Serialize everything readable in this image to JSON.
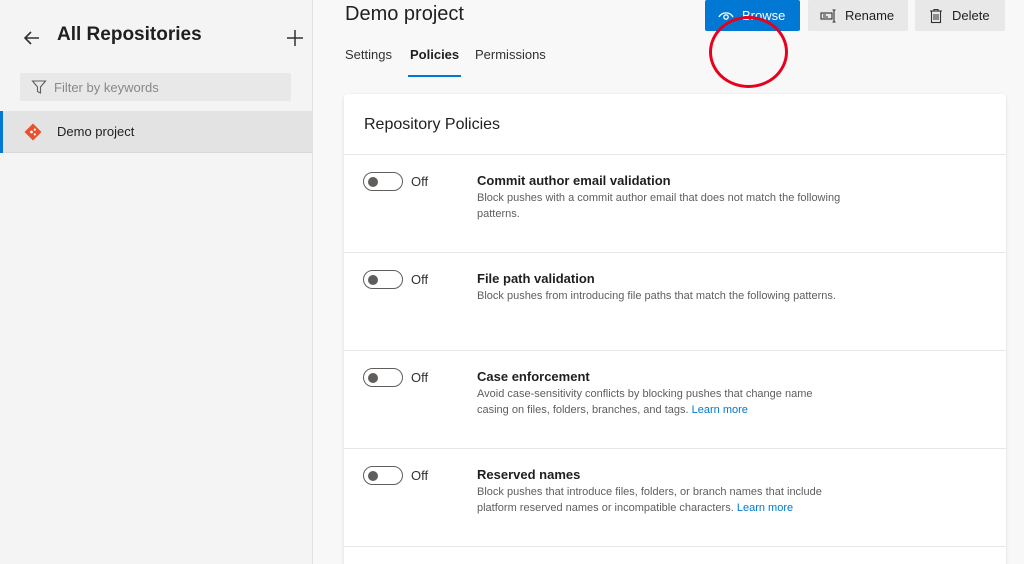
{
  "sidebar": {
    "title": "All Repositories",
    "filter_placeholder": "Filter by keywords",
    "repo_name": "Demo project"
  },
  "header": {
    "title": "Demo project",
    "browse_label": "Browse",
    "rename_label": "Rename",
    "delete_label": "Delete"
  },
  "tabs": [
    {
      "label": "Settings",
      "active": false
    },
    {
      "label": "Policies",
      "active": true
    },
    {
      "label": "Permissions",
      "active": false
    }
  ],
  "card": {
    "title": "Repository Policies"
  },
  "policies": [
    {
      "title": "Commit author email validation",
      "state": "Off",
      "description": "Block pushes with a commit author email that does not match the following patterns.",
      "link": ""
    },
    {
      "title": "File path validation",
      "state": "Off",
      "description": "Block pushes from introducing file paths that match the following patterns.",
      "link": ""
    },
    {
      "title": "Case enforcement",
      "state": "Off",
      "description": "Avoid case-sensitivity conflicts by blocking pushes that change name casing on files, folders, branches, and tags.",
      "link": "Learn more"
    },
    {
      "title": "Reserved names",
      "state": "Off",
      "description": "Block pushes that introduce files, folders, or branch names that include platform reserved names or incompatible characters.",
      "link": "Learn more"
    }
  ],
  "colors": {
    "accent": "#0078d4",
    "annotation": "#e8001c",
    "repo_icon": "#e8512c"
  },
  "icons": {
    "back": "arrow-left-icon",
    "add": "plus-icon",
    "filter": "funnel-icon",
    "repo": "git-diamond-icon",
    "browse": "eye-icon",
    "rename": "rename-icon",
    "delete": "trash-icon"
  }
}
